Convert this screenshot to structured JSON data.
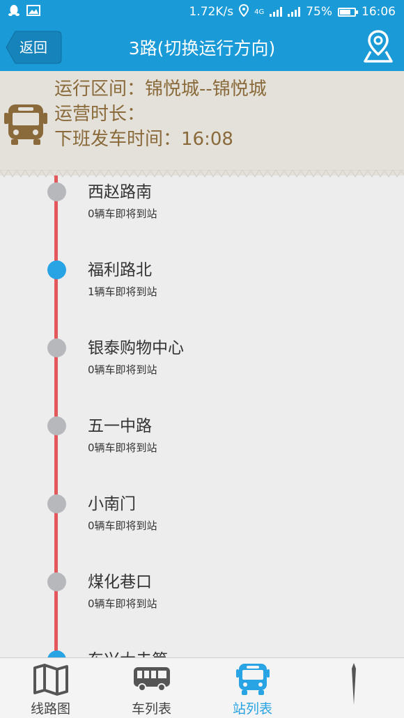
{
  "status_bar": {
    "speed": "1.72K/s",
    "network": "4G",
    "battery": "75%",
    "battery_level": 0.75,
    "time": "16:06"
  },
  "header": {
    "back_label": "返回",
    "title": "3路(切换运行方向)"
  },
  "info": {
    "route_range": "运行区间：锦悦城--锦悦城",
    "duration": "运营时长：",
    "next_departure": "下班发车时间：16:08"
  },
  "stations": [
    {
      "name": "西赵路南",
      "arriving": "0辆车即将到站",
      "has_bus": false
    },
    {
      "name": "福利路北",
      "arriving": "1辆车即将到站",
      "has_bus": true
    },
    {
      "name": "银泰购物中心",
      "arriving": "0辆车即将到站",
      "has_bus": false
    },
    {
      "name": "五一中路",
      "arriving": "0辆车即将到站",
      "has_bus": false
    },
    {
      "name": "小南门",
      "arriving": "0辆车即将到站",
      "has_bus": false
    },
    {
      "name": "煤化巷口",
      "arriving": "0辆车即将到站",
      "has_bus": false
    },
    {
      "name": "东兴大夫第",
      "arriving": "",
      "has_bus": true
    }
  ],
  "tabs": [
    {
      "label": "线路图",
      "icon": "map-icon",
      "active": false
    },
    {
      "label": "车列表",
      "icon": "bus-list-icon",
      "active": false
    },
    {
      "label": "站列表",
      "icon": "station-bus-icon",
      "active": true
    }
  ],
  "colors": {
    "header_bg": "#1a9ad6",
    "rail": "#e2585d",
    "active_dot": "#28a3e4",
    "info_text": "#8a6a3a"
  }
}
